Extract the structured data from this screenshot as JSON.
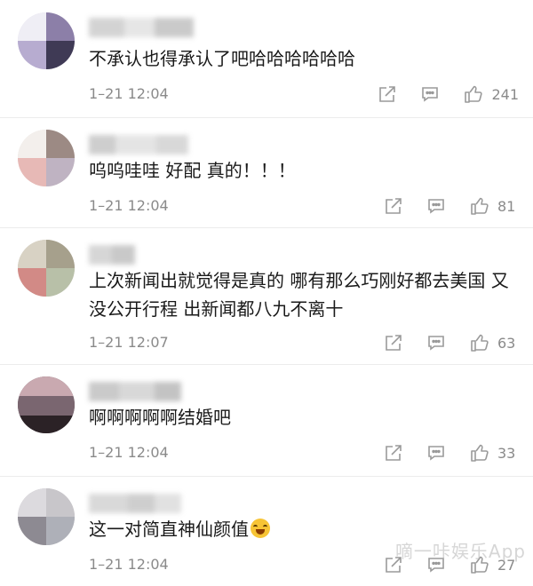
{
  "comments": [
    {
      "text": "不承认也得承认了吧哈哈哈哈哈哈",
      "time": "1–21 12:04",
      "likes": "241"
    },
    {
      "text": "呜呜哇哇 好配 真的！！！",
      "time": "1–21 12:04",
      "likes": "81"
    },
    {
      "text": "上次新闻出就觉得是真的 哪有那么巧刚好都去美国 又没公开行程 出新闻都八九不离十",
      "time": "1–21 12:07",
      "likes": "63"
    },
    {
      "text": "啊啊啊啊啊结婚吧",
      "time": "1–21 12:04",
      "likes": "33"
    },
    {
      "text": "这一对简直神仙颜值",
      "time": "1–21 12:04",
      "likes": "27"
    }
  ],
  "watermark": "嘀一咔娱乐App",
  "icons": [
    "share-icon",
    "comment-icon",
    "like-icon",
    "crying-laughing-emoji"
  ],
  "colors": {
    "text": "#1a1a1a",
    "meta": "#8a8a8a",
    "divider": "#ececec"
  }
}
